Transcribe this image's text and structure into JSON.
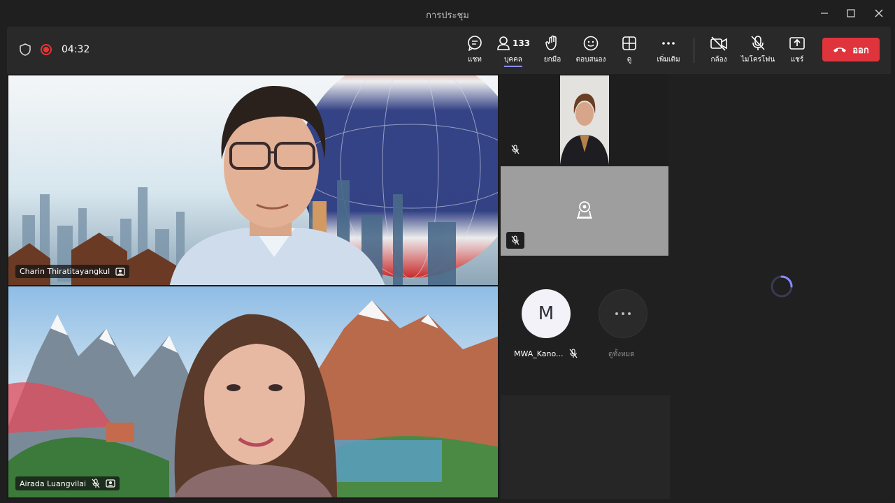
{
  "window": {
    "title": "การประชุม"
  },
  "meeting": {
    "timer": "04:32"
  },
  "toolbar": {
    "chat": "แชท",
    "people": "บุคคล",
    "people_count": "133",
    "raise_hand": "ยกมือ",
    "react": "ตอบสนอง",
    "view": "ดู",
    "more": "เพิ่มเติม",
    "camera": "กล้อง",
    "mic": "ไมโครโฟน",
    "share": "แชร์",
    "leave": "ออก"
  },
  "participants": {
    "main1": {
      "name": "Charin Thiratitayangkul"
    },
    "main2": {
      "name": "Airada Luangvilai"
    },
    "small_avatar": {
      "initial": "M",
      "name": "MWA_Kano..."
    },
    "view_all": "ดูทั้งหมด"
  },
  "colors": {
    "accent": "#8b8cf5",
    "leave": "#e0343c",
    "toolbar": "#292929"
  }
}
